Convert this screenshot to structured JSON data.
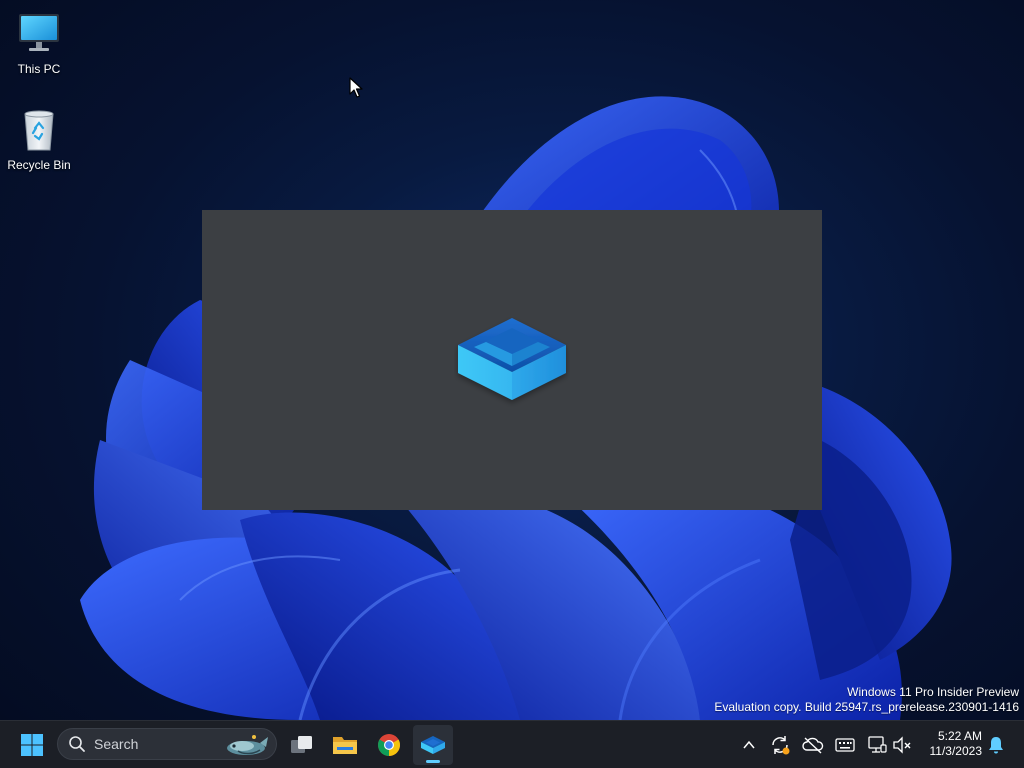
{
  "desktop": {
    "icons": [
      {
        "label": "This PC",
        "icon": "monitor-icon"
      },
      {
        "label": "Recycle Bin",
        "icon": "recycle-bin-icon"
      }
    ]
  },
  "splash": {
    "icon": "sandbox-box-icon"
  },
  "watermark": {
    "line1": "Windows 11 Pro Insider Preview",
    "line2": "Evaluation copy. Build 25947.rs_prerelease.230901-1416"
  },
  "taskbar": {
    "search": {
      "label": "Search"
    },
    "apps": [
      {
        "name": "Start",
        "icon": "windows-start-icon"
      },
      {
        "name": "Task View",
        "icon": "task-view-icon"
      },
      {
        "name": "File Explorer",
        "icon": "folder-icon"
      },
      {
        "name": "Google Chrome",
        "icon": "chrome-icon"
      },
      {
        "name": "Windows Sandbox",
        "icon": "sandbox-icon",
        "active": true
      }
    ],
    "tray": {
      "icons": [
        "chevron-up-icon",
        "sync-icon",
        "onedrive-off-icon",
        "keyboard-icon",
        "network-icon",
        "volume-muted-icon",
        "notification-bell-icon"
      ]
    },
    "clock": {
      "time": "5:22 AM",
      "date": "11/3/2023"
    }
  },
  "colors": {
    "accent": "#60cdff",
    "taskbar": "#1c1f26",
    "splash": "#3c3f43"
  }
}
